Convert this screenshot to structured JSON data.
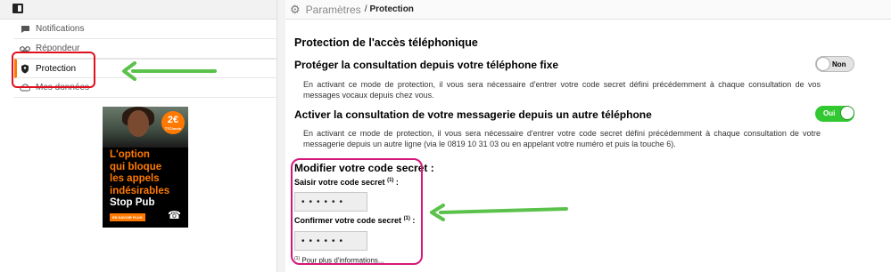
{
  "sidebar": {
    "items": [
      {
        "label": "Notifications",
        "icon": "chat-icon"
      },
      {
        "label": "Répondeur",
        "icon": "voicemail-icon"
      },
      {
        "label": "Protection",
        "icon": "shield-icon"
      },
      {
        "label": "Mes données",
        "icon": "cloud-icon"
      }
    ],
    "active_color": "#ff7900"
  },
  "ad": {
    "price": "2€",
    "price_note": "TTC/mois",
    "line1": "L'option",
    "line2": "qui bloque",
    "line3": "les appels",
    "line4": "indésirables",
    "line5": "Stop Pub",
    "cta": "EN SAVOIR PLUS"
  },
  "header": {
    "title": "Paramètres",
    "separator": "/",
    "subtitle": "Protection"
  },
  "main": {
    "section_title": "Protection de l'accès téléphonique",
    "option1": {
      "label": "Protéger la consultation depuis votre téléphone fixe",
      "toggle": "Non",
      "state": false,
      "description": "En activant ce mode de protection, il vous sera nécessaire d'entrer votre code secret défini précédemment à chaque consultation de vos messages vocaux depuis chez vous."
    },
    "option2": {
      "label": "Activer la consultation de votre messagerie depuis un autre téléphone",
      "toggle": "Oui",
      "state": true,
      "description": "En activant ce mode de protection, il vous sera nécessaire d'entrer votre code secret défini précédemment à chaque consultation de votre messagerie depuis un autre ligne (via le 0819 10 31 03 ou en appelant votre numéro et puis la touche 6)."
    },
    "code": {
      "title": "Modifier votre code secret :",
      "enter_label": "Saisir votre code secret",
      "enter_sup": "(1)",
      "enter_colon": " :",
      "enter_value": "••••••",
      "confirm_label": "Confirmer votre code secret",
      "confirm_sup": "(1)",
      "confirm_colon": " :",
      "confirm_value": "••••••",
      "footnote_sup": "(1)",
      "footnote": " Pour plus d'informations..."
    }
  },
  "colors": {
    "toggle_on": "#32c832",
    "annotation_red": "#e0101e",
    "annotation_pink": "#d4187c",
    "annotation_arrow": "#5ac24a"
  }
}
